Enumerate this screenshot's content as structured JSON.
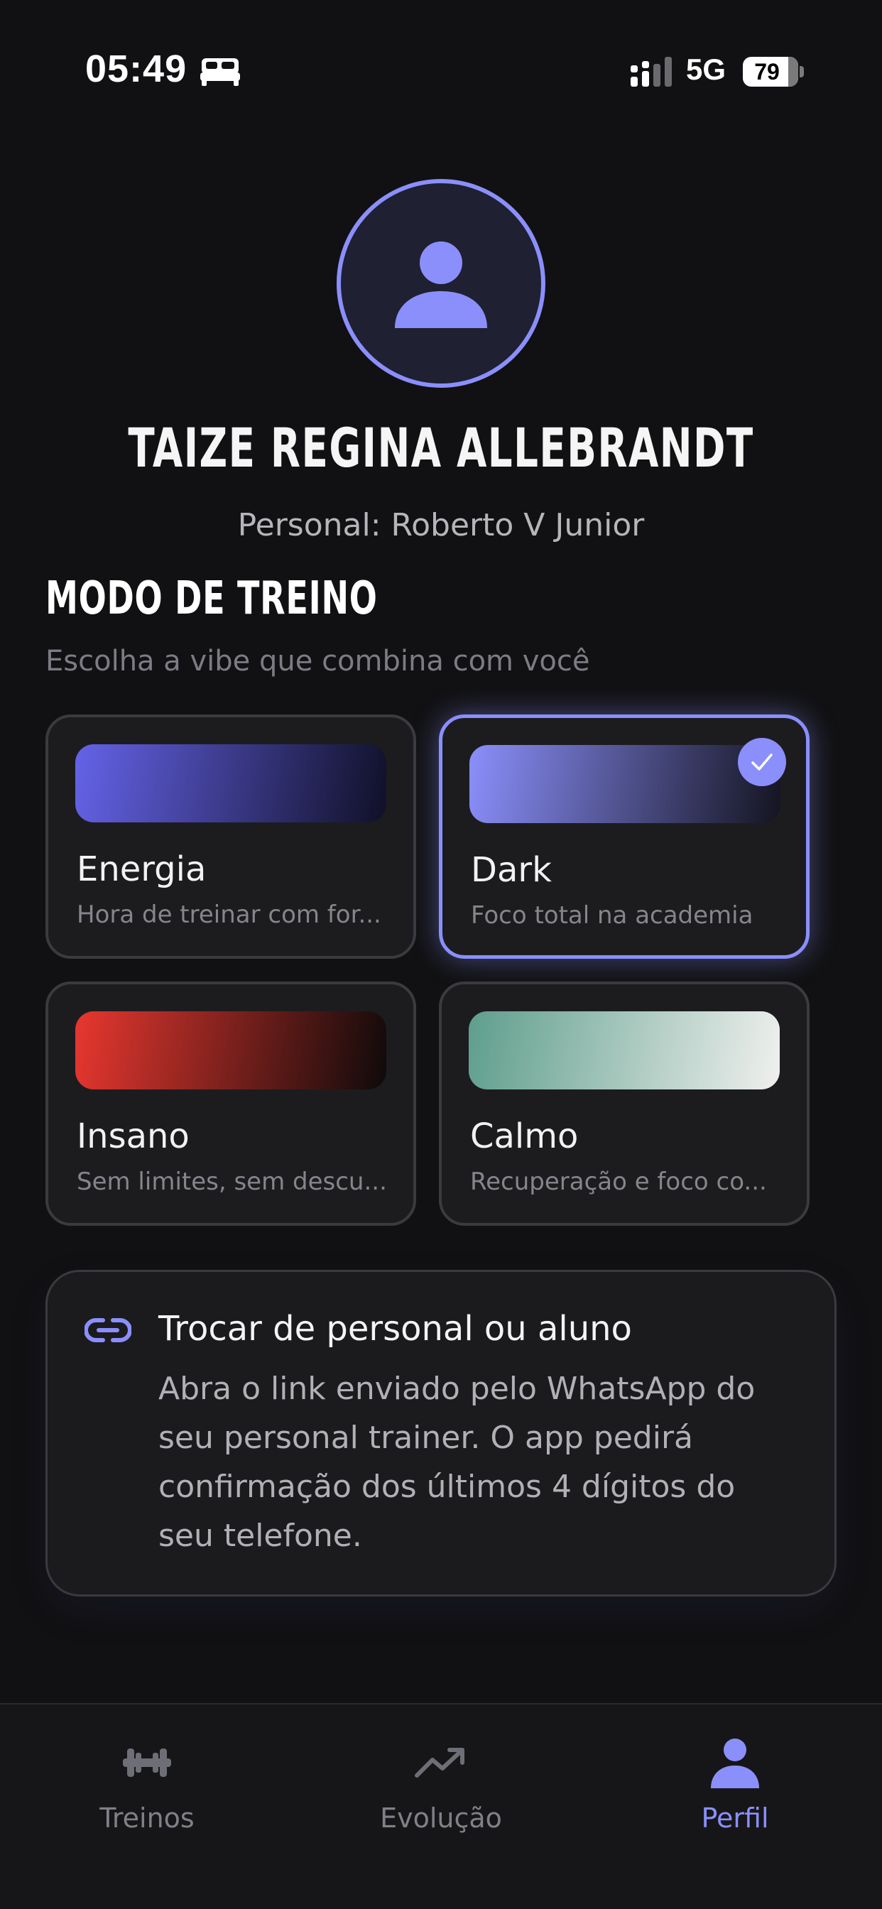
{
  "status_bar": {
    "time": "05:49",
    "network": "5G",
    "battery": "79",
    "icons": [
      "bed-icon",
      "signal-icon",
      "battery-icon"
    ]
  },
  "profile": {
    "avatar_icon": "user-icon",
    "name": "TAIZE REGINA ALLEBRANDT",
    "personal": "Personal: Roberto V Junior"
  },
  "modes": {
    "title": "MODO DE TREINO",
    "subtitle": "Escolha a vibe que combina com você",
    "items": [
      {
        "name": "Energia",
        "desc": "Hora de treinar com for...",
        "colors": [
          "#6563e8",
          "#101028"
        ],
        "selected": false
      },
      {
        "name": "Dark",
        "desc": "Foco total na academia",
        "colors": [
          "#8b8ffb",
          "#141420"
        ],
        "selected": true
      },
      {
        "name": "Insano",
        "desc": "Sem limites, sem descu...",
        "colors": [
          "#e8372f",
          "#0e0a0a"
        ],
        "selected": false
      },
      {
        "name": "Calmo",
        "desc": "Recuperação e foco co...",
        "colors": [
          "#5e9e8c",
          "#f0f0ee"
        ],
        "selected": false
      }
    ]
  },
  "info": {
    "icon": "link-icon",
    "title": "Trocar de personal ou aluno",
    "body": "Abra o link enviado pelo WhatsApp do seu personal trainer. O app pedirá confirmação dos últimos 4 dígitos do seu telefone."
  },
  "tabs": {
    "items": [
      {
        "label": "Treinos",
        "icon": "dumbbell-icon",
        "active": false
      },
      {
        "label": "Evolução",
        "icon": "trending-up-icon",
        "active": false
      },
      {
        "label": "Perfil",
        "icon": "user-icon",
        "active": true
      }
    ]
  },
  "colors": {
    "accent": "#8b8ffb",
    "background": "#111113",
    "card": "#1c1c1f",
    "border": "#3a3a3f"
  }
}
